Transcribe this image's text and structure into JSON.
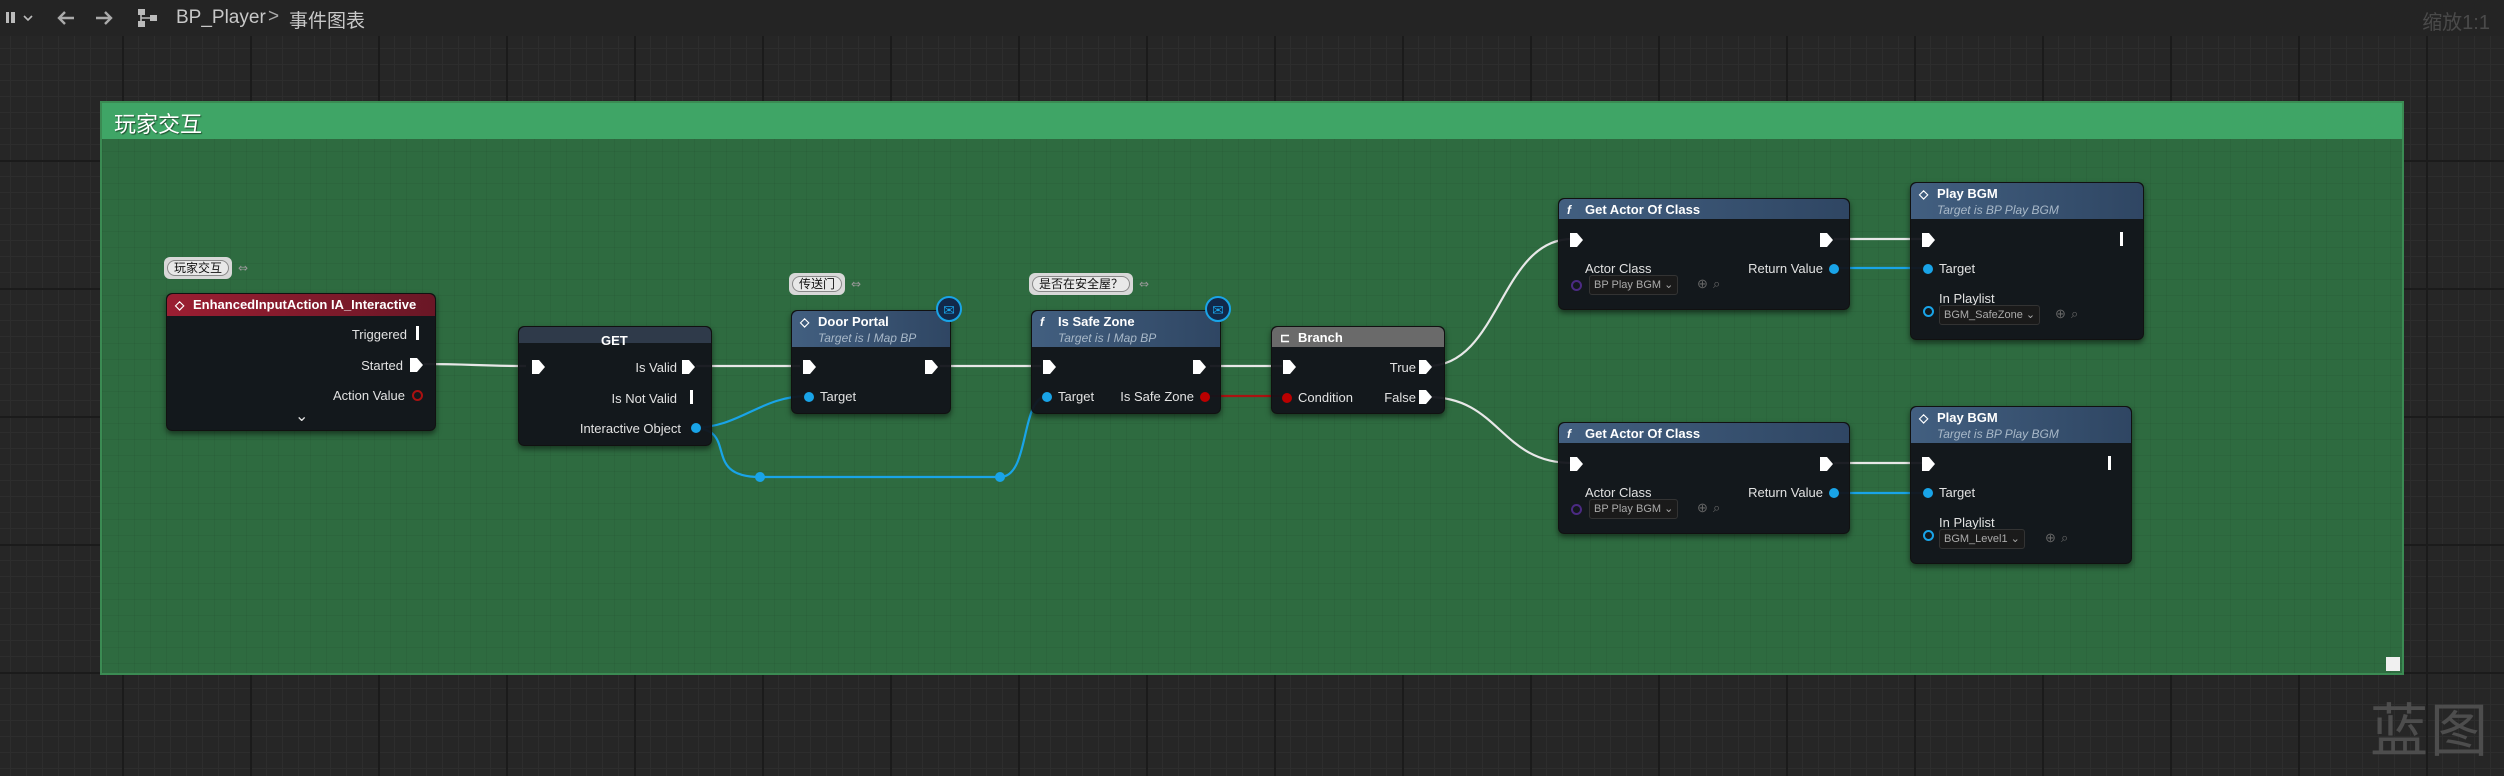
{
  "topbar": {
    "menu_icon": "blueprint-menu-icon",
    "back_icon": "back-arrow-icon",
    "forward_icon": "forward-arrow-icon",
    "graph_icon": "graph-tree-icon",
    "crumb_blueprint": "BP_Player",
    "crumb_separator": ">",
    "crumb_graph": "事件图表",
    "zoom": "缩放1:1"
  },
  "watermark": "蓝图",
  "comment": {
    "title": "玩家交互"
  },
  "bubbles": {
    "input": "玩家交互",
    "door": "传送门",
    "safe": "是否在安全屋？"
  },
  "nodes": {
    "input_event": {
      "title": "EnhancedInputAction IA_Interactive",
      "pins": [
        "Triggered",
        "Started",
        "Action Value"
      ],
      "expand": "⌄"
    },
    "get": {
      "title": "GET",
      "pins": [
        "Is Valid",
        "Is Not Valid",
        "Interactive Object"
      ]
    },
    "door_portal": {
      "title": "Door Portal",
      "subtitle": "Target is I Map BP",
      "pins": [
        "Target"
      ]
    },
    "is_safe_zone": {
      "title": "Is Safe Zone",
      "subtitle": "Target is I Map BP",
      "pins": [
        "Target",
        "Is Safe Zone"
      ]
    },
    "branch": {
      "title": "Branch",
      "pins": [
        "Condition",
        "True",
        "False"
      ]
    },
    "get_actor_1": {
      "title": "Get Actor Of Class",
      "pins": [
        "Actor Class",
        "Return Value"
      ],
      "class_value": "BP Play BGM"
    },
    "get_actor_2": {
      "title": "Get Actor Of Class",
      "pins": [
        "Actor Class",
        "Return Value"
      ],
      "class_value": "BP Play BGM"
    },
    "play_bgm_1": {
      "title": "Play BGM",
      "subtitle": "Target is BP Play BGM",
      "pins": [
        "Target",
        "In Playlist"
      ],
      "playlist_value": "BGM_SafeZone"
    },
    "play_bgm_2": {
      "title": "Play BGM",
      "subtitle": "Target is BP Play BGM",
      "pins": [
        "Target",
        "In Playlist"
      ],
      "playlist_value": "BGM_Level1"
    }
  },
  "colors": {
    "comment_bg": "#2e6b40",
    "comment_header": "#3fa566",
    "event_header": "#8a1d2e",
    "function_header": "#3d5a7c",
    "branch_header": "#6d6d6d",
    "object_pin": "#19a4e8",
    "bool_pin": "#aa1111",
    "class_pin": "#4b2a83"
  }
}
